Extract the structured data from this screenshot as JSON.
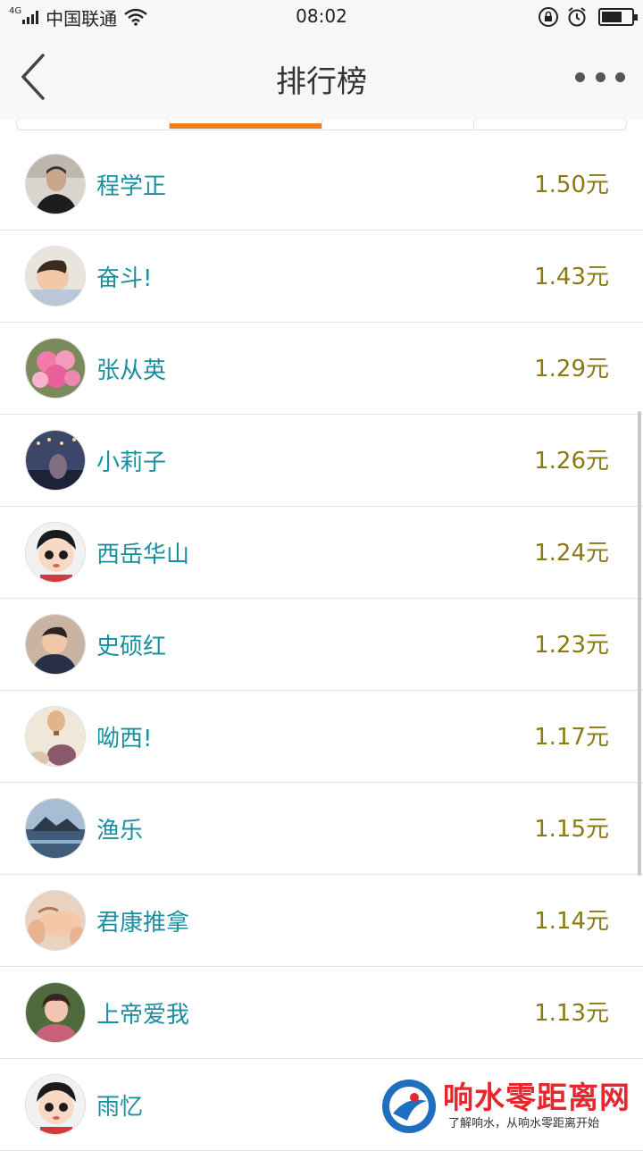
{
  "status_bar": {
    "network": "4G",
    "carrier": "中国联通",
    "time": "08:02",
    "battery_level": 0.7
  },
  "nav": {
    "title": "排行榜"
  },
  "tabs": {
    "count": 4,
    "active_index": 1
  },
  "colors": {
    "accent": "#f07c1a",
    "name": "#1a8fa0",
    "amount": "#8a7a10"
  },
  "ranking": [
    {
      "name": "程学正",
      "amount": "1.50元",
      "avatar": "man-portrait-avatar"
    },
    {
      "name": "奋斗!",
      "amount": "1.43元",
      "avatar": "child-avatar"
    },
    {
      "name": "张从英",
      "amount": "1.29元",
      "avatar": "pink-flowers-avatar"
    },
    {
      "name": "小莉子",
      "amount": "1.26元",
      "avatar": "night-lights-avatar"
    },
    {
      "name": "西岳华山",
      "amount": "1.24元",
      "avatar": "cartoon-boy-avatar"
    },
    {
      "name": "史硕红",
      "amount": "1.23元",
      "avatar": "baby-avatar"
    },
    {
      "name": "呦西!",
      "amount": "1.17元",
      "avatar": "hot-air-balloon-avatar"
    },
    {
      "name": "渔乐",
      "amount": "1.15元",
      "avatar": "seascape-avatar"
    },
    {
      "name": "君康推拿",
      "amount": "1.14元",
      "avatar": "massage-avatar"
    },
    {
      "name": "上帝爱我",
      "amount": "1.13元",
      "avatar": "girl-avatar"
    },
    {
      "name": "雨忆",
      "amount": "",
      "avatar": "cartoon-boy-avatar"
    }
  ],
  "watermark": {
    "title": "响水零距离网",
    "subtitle": "了解响水，从响水零距离开始"
  }
}
